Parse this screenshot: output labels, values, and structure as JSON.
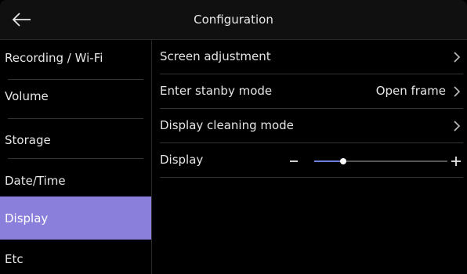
{
  "header": {
    "title": "Configuration",
    "back_icon": "arrow-left-icon"
  },
  "sidebar": {
    "items": [
      {
        "label": "Recording / Wi-Fi",
        "active": false
      },
      {
        "label": "Volume",
        "active": false
      },
      {
        "label": "Storage",
        "active": false
      },
      {
        "label": "Date/Time",
        "active": false
      },
      {
        "label": "Display",
        "active": true
      },
      {
        "label": "Etc",
        "active": false
      }
    ],
    "active_color": "#8b7fdc"
  },
  "settings": {
    "screen_adjustment": {
      "label": "Screen adjustment"
    },
    "standby": {
      "label": "Enter stanby mode",
      "value": "Open frame"
    },
    "cleaning": {
      "label": "Display cleaning mode"
    },
    "display": {
      "label": "Display",
      "level": 0.22,
      "minus": "−",
      "plus": "+"
    }
  },
  "colors": {
    "slider_fill": "#6f7fe0",
    "slider_track": "#555555"
  }
}
